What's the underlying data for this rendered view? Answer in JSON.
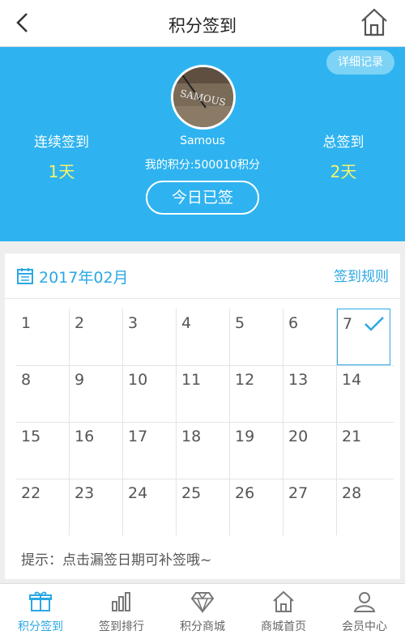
{
  "header": {
    "title": "积分签到",
    "back_icon": "chevron-left-icon",
    "home_icon": "home-icon"
  },
  "profile": {
    "detail_label": "详细记录",
    "username": "Samous",
    "points_text": "我的积分:500010积分",
    "streak_label": "连续签到",
    "streak_value": "1天",
    "total_label": "总签到",
    "total_value": "2天",
    "signed_label": "今日已签",
    "avatar_text": "SAMOUS"
  },
  "calendar": {
    "month": "2017年02月",
    "rules_label": "签到规则",
    "days": [
      "1",
      "2",
      "3",
      "4",
      "5",
      "6",
      "7",
      "8",
      "9",
      "10",
      "11",
      "12",
      "13",
      "14",
      "15",
      "16",
      "17",
      "18",
      "19",
      "20",
      "21",
      "22",
      "23",
      "24",
      "25",
      "26",
      "27",
      "28"
    ],
    "signed_day": "7",
    "tip": "提示：点击漏签日期可补签哦~"
  },
  "tabs": [
    {
      "label": "积分签到",
      "icon": "gift-icon",
      "active": true
    },
    {
      "label": "签到排行",
      "icon": "bar-chart-icon",
      "active": false
    },
    {
      "label": "积分商城",
      "icon": "diamond-icon",
      "active": false
    },
    {
      "label": "商城首页",
      "icon": "home-icon",
      "active": false
    },
    {
      "label": "会员中心",
      "icon": "user-icon",
      "active": false
    }
  ],
  "colors": {
    "accent": "#2aa8e4",
    "hero": "#2eb3f0",
    "highlight": "#f6f36a"
  }
}
